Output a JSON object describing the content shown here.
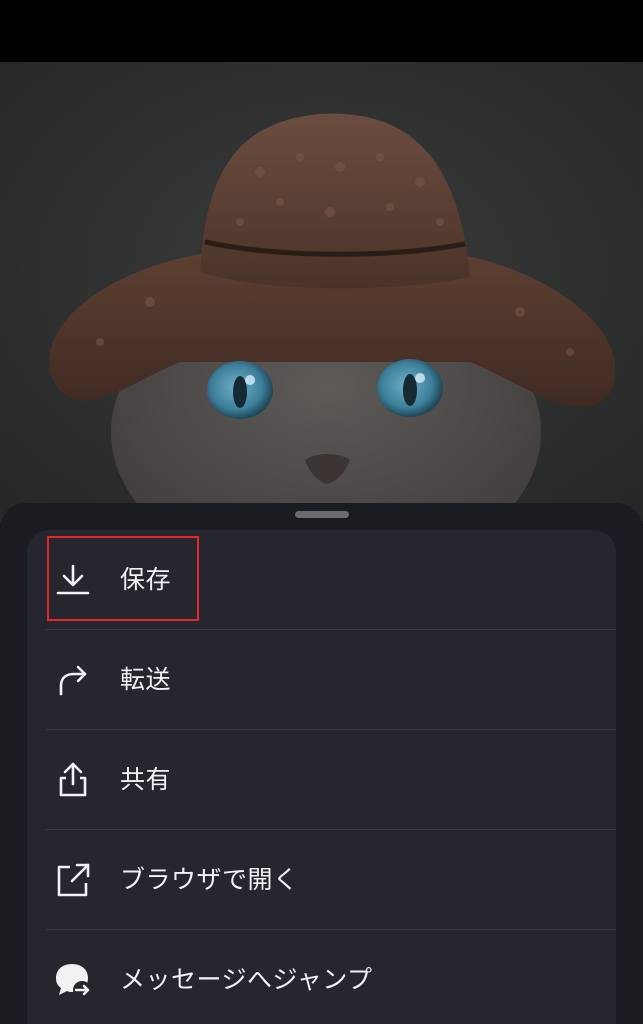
{
  "photo": {
    "subject": "cat-wearing-knit-hat"
  },
  "colors": {
    "sheet_background": "#1b1c21",
    "menu_background": "#26272e",
    "text": "#f2f2f4",
    "highlight": "#e5262a"
  },
  "menu": {
    "items": [
      {
        "label": "保存",
        "icon": "download-icon"
      },
      {
        "label": "転送",
        "icon": "forward-arrow-icon"
      },
      {
        "label": "共有",
        "icon": "share-icon"
      },
      {
        "label": "ブラウザで開く",
        "icon": "open-external-icon"
      },
      {
        "label": "メッセージへジャンプ",
        "icon": "jump-to-message-icon"
      }
    ]
  }
}
